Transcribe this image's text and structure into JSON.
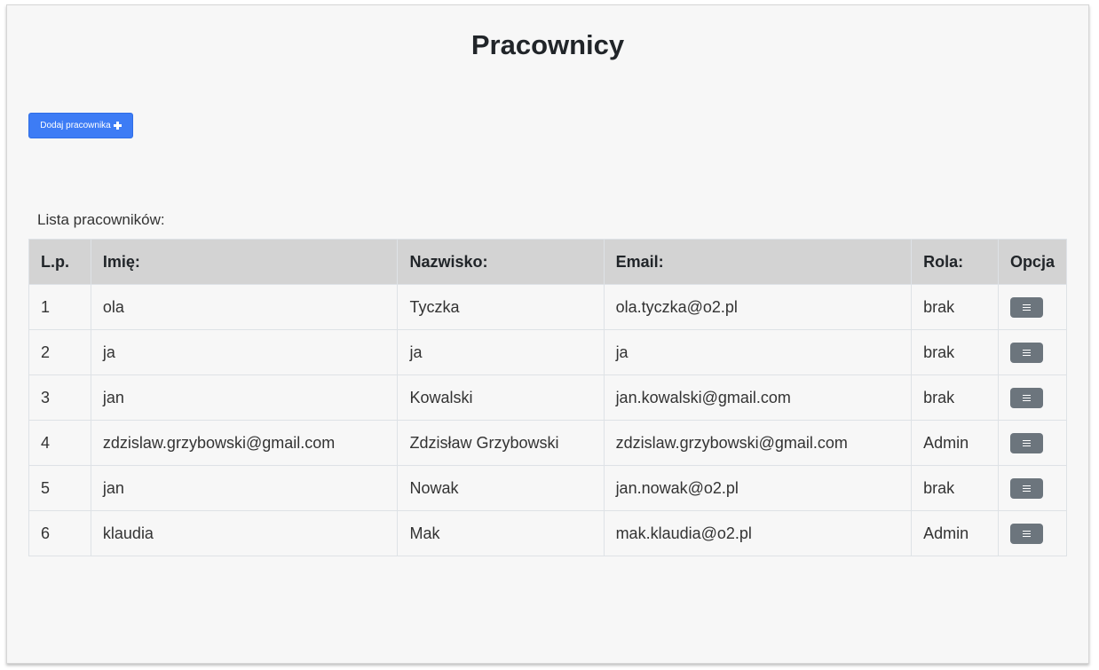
{
  "page": {
    "title": "Pracownicy"
  },
  "toolbar": {
    "add_label": "Dodaj pracownika",
    "add_icon": "plus-icon"
  },
  "list": {
    "caption": "Lista pracowników:",
    "headers": {
      "lp": "L.p.",
      "imie": "Imię:",
      "nazwisko": "Nazwisko:",
      "email": "Email:",
      "rola": "Rola:",
      "opcja": "Opcja"
    },
    "option_icon": "menu-icon",
    "rows": [
      {
        "lp": "1",
        "imie": "ola",
        "nazwisko": "Tyczka",
        "email": "ola.tyczka@o2.pl",
        "rola": "brak"
      },
      {
        "lp": "2",
        "imie": "ja",
        "nazwisko": "ja",
        "email": "ja",
        "rola": "brak"
      },
      {
        "lp": "3",
        "imie": "jan",
        "nazwisko": "Kowalski",
        "email": "jan.kowalski@gmail.com",
        "rola": "brak"
      },
      {
        "lp": "4",
        "imie": "zdzislaw.grzybowski@gmail.com",
        "nazwisko": "Zdzisław Grzybowski",
        "email": "zdzislaw.grzybowski@gmail.com",
        "rola": "Admin"
      },
      {
        "lp": "5",
        "imie": "jan",
        "nazwisko": "Nowak",
        "email": "jan.nowak@o2.pl",
        "rola": "brak"
      },
      {
        "lp": "6",
        "imie": "klaudia",
        "nazwisko": "Mak",
        "email": "mak.klaudia@o2.pl",
        "rola": "Admin"
      }
    ]
  },
  "colors": {
    "primary": "#3d7cf5",
    "secondary": "#6c757d",
    "header_bg": "#d3d3d3",
    "panel_bg": "#f7f7f7"
  }
}
